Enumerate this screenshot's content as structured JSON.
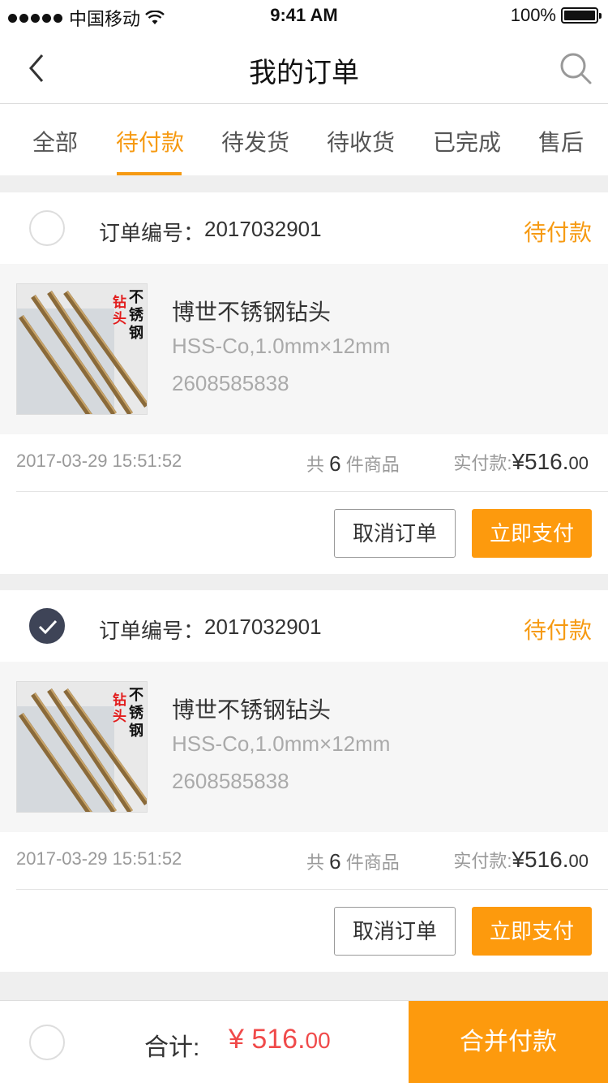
{
  "status_bar": {
    "carrier": "中国移动",
    "time": "9:41 AM",
    "battery_text": "100%",
    "battery_level": 1.0,
    "icons": [
      "signal-dots-icon",
      "wifi-icon",
      "battery-icon"
    ]
  },
  "nav": {
    "title": "我的订单",
    "back_icon": "chevron-left-icon",
    "search_icon": "search-icon"
  },
  "tabs": [
    {
      "label": "全部",
      "active": false
    },
    {
      "label": "待付款",
      "active": true
    },
    {
      "label": "待发货",
      "active": false
    },
    {
      "label": "待收货",
      "active": false
    },
    {
      "label": "已完成",
      "active": false
    },
    {
      "label": "售后",
      "active": false
    }
  ],
  "colors": {
    "accent": "#f69a12",
    "button_orange": "#fd9a0d",
    "price_red": "#f04a4a",
    "checked": "#3e4457"
  },
  "orders": [
    {
      "selected": false,
      "order_no_label": "订单编号：",
      "order_no": "2017032901",
      "status": "待付款",
      "product": {
        "name": "博世不锈钢钻头",
        "spec": "HSS-Co,1.0mm×12mm",
        "code": "2608585838",
        "image_text_1": "钻头",
        "image_text_2": "不锈钢"
      },
      "date": "2017-03-29 15:51:52",
      "count_prefix": "共",
      "count": "6",
      "count_suffix": "件商品",
      "paid_label": "实付款:",
      "paid_amount": "¥516.",
      "paid_decimals": "00",
      "cancel_label": "取消订单",
      "pay_label": "立即支付"
    },
    {
      "selected": true,
      "order_no_label": "订单编号：",
      "order_no": "2017032901",
      "status": "待付款",
      "product": {
        "name": "博世不锈钢钻头",
        "spec": "HSS-Co,1.0mm×12mm",
        "code": "2608585838",
        "image_text_1": "钻头",
        "image_text_2": "不锈钢"
      },
      "date": "2017-03-29 15:51:52",
      "count_prefix": "共",
      "count": "6",
      "count_suffix": "件商品",
      "paid_label": "实付款:",
      "paid_amount": "¥516.",
      "paid_decimals": "00",
      "cancel_label": "取消订单",
      "pay_label": "立即支付"
    }
  ],
  "bottom_bar": {
    "total_label": "合计:",
    "total_amount": "¥ 516.",
    "total_decimals": "00",
    "merge_pay_label": "合并付款",
    "selected": false
  }
}
